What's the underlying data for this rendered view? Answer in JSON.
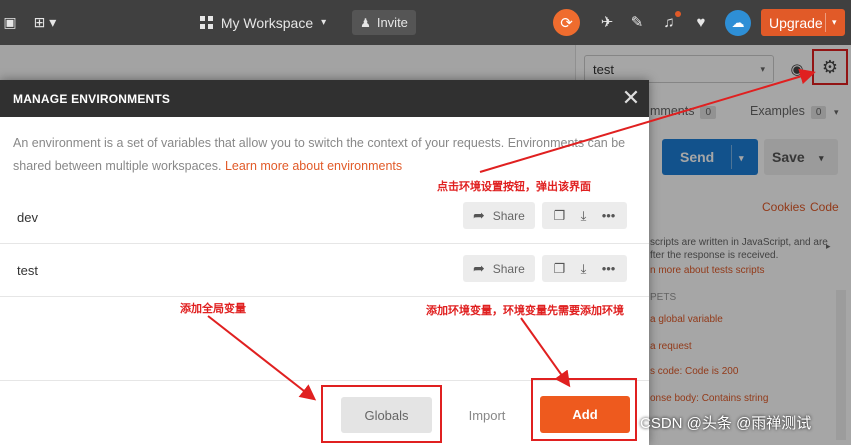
{
  "header": {
    "workspace_label": "My Workspace",
    "invite_label": "Invite",
    "upgrade_label": "Upgrade"
  },
  "right_panel": {
    "environment_selected": "test",
    "comments_label": "mments",
    "comments_count": "0",
    "examples_label": "Examples",
    "examples_count": "0",
    "send_label": "Send",
    "save_label": "Save",
    "cookies_label": "Cookies",
    "code_label": "Code",
    "tests_desc_1": "scripts are written in JavaScript, and are",
    "tests_desc_2": "fter the response is received.",
    "tests_link": "n more about tests scripts",
    "snippets_label": "PETS",
    "snippets": [
      "a global variable",
      "a request",
      "s code: Code is 200",
      "onse body: Contains string"
    ]
  },
  "modal": {
    "title": "MANAGE ENVIRONMENTS",
    "description": "An environment is a set of variables that allow you to switch the context of your requests. Environments can be shared between multiple workspaces.",
    "learn_more": "Learn more about environments",
    "environments": [
      {
        "name": "dev",
        "share_label": "Share"
      },
      {
        "name": "test",
        "share_label": "Share"
      }
    ],
    "globals_label": "Globals",
    "import_label": "Import",
    "add_label": "Add"
  },
  "annotations": {
    "settings_note": "点击环境设置按钮，弹出该界面",
    "globals_note": "添加全局变量",
    "add_note": "添加环境变量，环境变量先需要添加环境"
  },
  "watermark": "CSDN @头条 @雨禅测试",
  "colors": {
    "accent_orange": "#ee5a1e",
    "send_blue": "#1d7fd8",
    "annotation_red": "#e02020",
    "header_dark": "#404040"
  }
}
